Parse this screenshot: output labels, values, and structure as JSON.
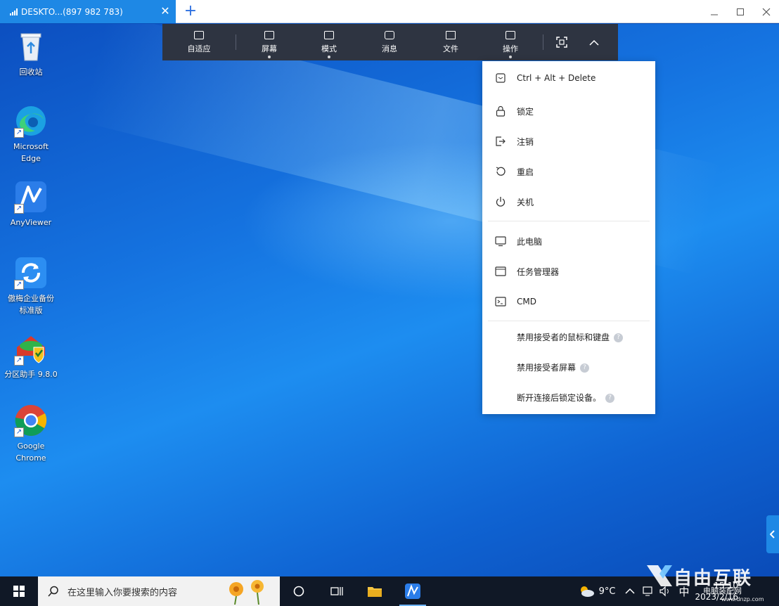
{
  "window": {
    "tab_title": "DESKTO...(897 982 783)",
    "tab_close": "✕",
    "new_tab": "+",
    "minimize": "—",
    "maximize": "☐",
    "close": "✕"
  },
  "desktop_icons": [
    {
      "label": "回收站"
    },
    {
      "label": "Microsoft Edge"
    },
    {
      "label": "AnyViewer"
    },
    {
      "label": "傲梅企业备份 标准版"
    },
    {
      "label": "分区助手 9.8.0"
    },
    {
      "label": "Google Chrome"
    }
  ],
  "toolbar": {
    "items": [
      {
        "label": "自适应"
      },
      {
        "label": "屏幕"
      },
      {
        "label": "模式"
      },
      {
        "label": "消息"
      },
      {
        "label": "文件"
      },
      {
        "label": "操作"
      }
    ]
  },
  "menu": {
    "items": [
      {
        "label": "Ctrl + Alt + Delete"
      },
      {
        "label": "锁定"
      },
      {
        "label": "注销"
      },
      {
        "label": "重启"
      },
      {
        "label": "关机"
      },
      {
        "label": "此电脑"
      },
      {
        "label": "任务管理器"
      },
      {
        "label": "CMD"
      },
      {
        "label": "禁用接受者的鼠标和键盘"
      },
      {
        "label": "禁用接受者屏幕"
      },
      {
        "label": "断开连接后锁定设备。"
      }
    ],
    "help_glyph": "?"
  },
  "taskbar": {
    "search_placeholder": "在这里输入你要搜索的内容",
    "weather_temp": "9°C",
    "ime": "中",
    "time": "15:10",
    "date": "2023/2/16"
  },
  "watermark": {
    "brand": "自由互联",
    "site": "电脑装配网",
    "url": "www.dnzp.com"
  },
  "colors": {
    "accent": "#1e88e5",
    "toolbar_bg": "#2e3441",
    "taskbar_bg": "#101826"
  }
}
